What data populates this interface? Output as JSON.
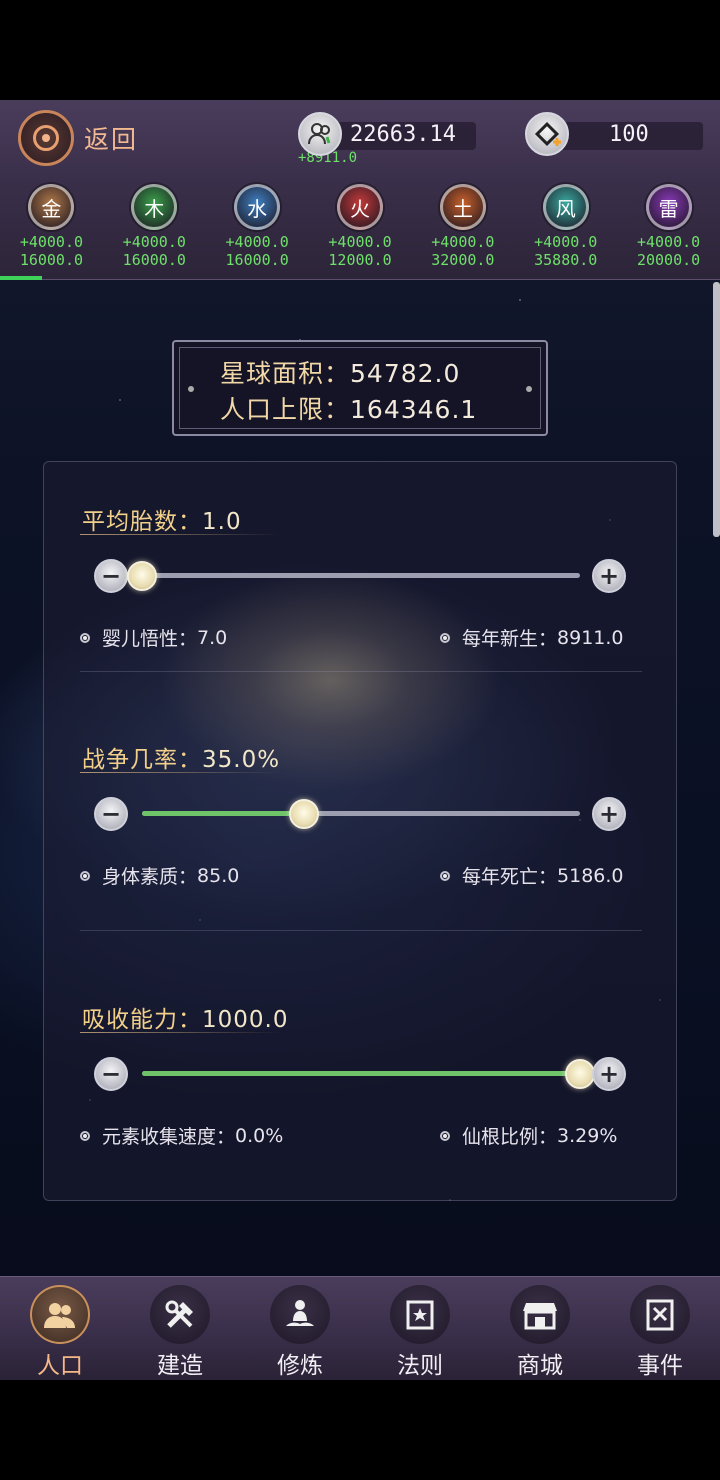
{
  "header": {
    "back_label": "返回",
    "population": "22663.14",
    "population_delta": "+8911.0",
    "gems": "100"
  },
  "elements": [
    {
      "name": "金",
      "color": "#b07848",
      "delta": "+4000.0",
      "total": "16000.0"
    },
    {
      "name": "木",
      "color": "#3aa04a",
      "delta": "+4000.0",
      "total": "16000.0"
    },
    {
      "name": "水",
      "color": "#3f7fc0",
      "delta": "+4000.0",
      "total": "16000.0"
    },
    {
      "name": "火",
      "color": "#c43a3a",
      "delta": "+4000.0",
      "total": "12000.0"
    },
    {
      "name": "土",
      "color": "#c8602a",
      "delta": "+4000.0",
      "total": "32000.0"
    },
    {
      "name": "风",
      "color": "#3aa9a0",
      "delta": "+4000.0",
      "total": "35880.0"
    },
    {
      "name": "雷",
      "color": "#8a3ab8",
      "delta": "+4000.0",
      "total": "20000.0"
    }
  ],
  "planet": {
    "area_label": "星球面积：",
    "area_value": "54782.0",
    "cap_label": "人口上限：",
    "cap_value": "164346.1"
  },
  "sliders": [
    {
      "label": "平均胎数：",
      "value": "1.0",
      "level": 0.0,
      "left_stat_label": "婴儿悟性：",
      "left_stat_value": "7.0",
      "right_stat_label": "每年新生：",
      "right_stat_value": "8911.0"
    },
    {
      "label": "战争几率：",
      "value": "35.0%",
      "level": 0.37,
      "left_stat_label": "身体素质：",
      "left_stat_value": "85.0",
      "right_stat_label": "每年死亡：",
      "right_stat_value": "5186.0"
    },
    {
      "label": "吸收能力：",
      "value": "1000.0",
      "level": 1.0,
      "left_stat_label": "元素收集速度：",
      "left_stat_value": "0.0%",
      "right_stat_label": "仙根比例：",
      "right_stat_value": "3.29%"
    }
  ],
  "nav": [
    {
      "label": "人口",
      "icon": "people-icon"
    },
    {
      "label": "建造",
      "icon": "tools-icon"
    },
    {
      "label": "修炼",
      "icon": "meditation-icon"
    },
    {
      "label": "法则",
      "icon": "scroll-icon"
    },
    {
      "label": "商城",
      "icon": "shop-icon"
    },
    {
      "label": "事件",
      "icon": "event-book-icon"
    }
  ]
}
